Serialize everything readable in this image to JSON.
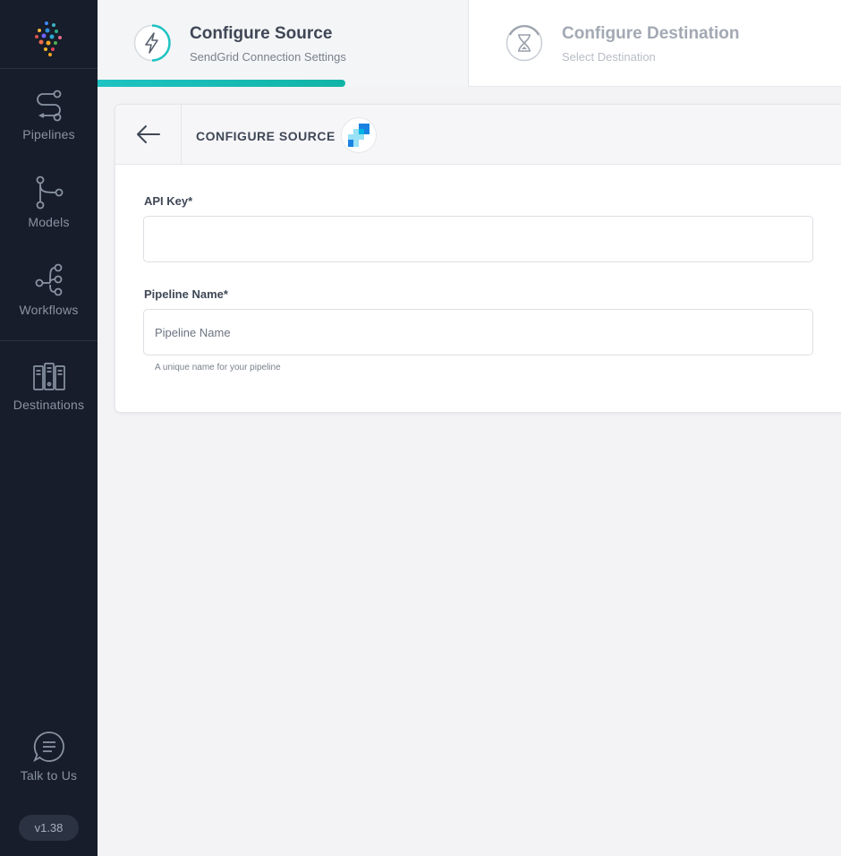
{
  "sidebar": {
    "items": [
      {
        "id": "pipelines",
        "label": "Pipelines",
        "icon": "pipelines-icon"
      },
      {
        "id": "models",
        "label": "Models",
        "icon": "models-icon"
      },
      {
        "id": "workflows",
        "label": "Workflows",
        "icon": "workflows-icon"
      },
      {
        "id": "destinations",
        "label": "Destinations",
        "icon": "destinations-icon"
      }
    ],
    "talk": {
      "label": "Talk to Us",
      "icon": "chat-icon"
    },
    "version": "v1.38"
  },
  "stepper": {
    "steps": [
      {
        "title": "Configure Source",
        "subtitle": "SendGrid Connection Settings",
        "state": "active",
        "icon": "lightning-icon"
      },
      {
        "title": "Configure Destination",
        "subtitle": "Select Destination",
        "state": "pending",
        "icon": "hourglass-icon"
      }
    ]
  },
  "card": {
    "title": "CONFIGURE SOURCE",
    "source_logo": "sendgrid-logo"
  },
  "form": {
    "api_key": {
      "label": "API Key*",
      "value": "",
      "placeholder": ""
    },
    "pipeline_name": {
      "label": "Pipeline Name*",
      "value": "",
      "placeholder": "Pipeline Name",
      "hint": "A unique name for your pipeline"
    }
  },
  "colors": {
    "sidebar_bg": "#171d2a",
    "accent": "#1ec3c2",
    "muted_text": "#a3a9b3"
  }
}
